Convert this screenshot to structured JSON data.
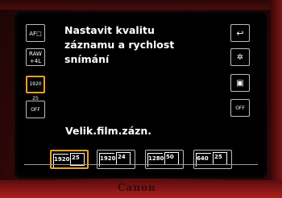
{
  "menu": {
    "title_line1": "Nastavit kvalitu",
    "title_line2": "záznamu a rychlost",
    "title_line3": "snímání",
    "section_label": "Velik.film.zázn."
  },
  "left_icons": [
    {
      "label": "AF□",
      "semantic": "af-mode-icon"
    },
    {
      "label": "RAW +4L",
      "semantic": "image-quality-icon"
    },
    {
      "label": "1920 25",
      "semantic": "movie-size-icon",
      "selected": true
    },
    {
      "label": "OFF",
      "semantic": "movie-servo-icon"
    }
  ],
  "right_icons": [
    {
      "label": "↩",
      "semantic": "return-icon"
    },
    {
      "label": "✲",
      "semantic": "white-balance-icon"
    },
    {
      "label": "▣",
      "semantic": "metering-icon"
    },
    {
      "label": "OFF",
      "semantic": "digital-zoom-icon"
    }
  ],
  "size_options": [
    {
      "res": "1920",
      "fps": "25",
      "selected": true
    },
    {
      "res": "1920",
      "fps": "24",
      "selected": false
    },
    {
      "res": "1280",
      "fps": "50",
      "selected": false
    },
    {
      "res": "640",
      "fps": "25",
      "selected": false
    }
  ],
  "brand": "Canon",
  "colors": {
    "selection": "#f0a020",
    "body": "#8a1414",
    "screen": "#000000"
  }
}
